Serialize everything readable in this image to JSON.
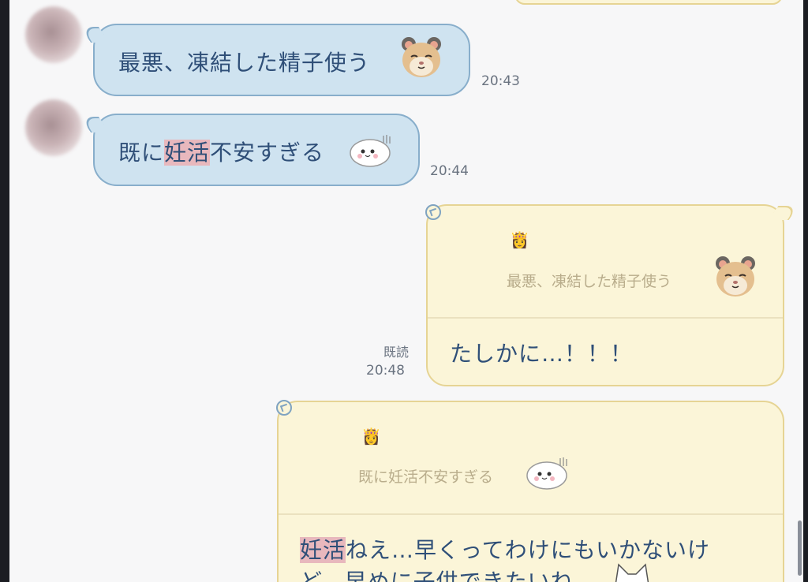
{
  "messages": [
    {
      "id": "m1",
      "direction": "incoming",
      "text": "最悪、凍結した精子使う",
      "sticker": "hamster-emoji",
      "time": "20:43"
    },
    {
      "id": "m2",
      "direction": "incoming",
      "text_pre": "既に",
      "text_hl": "妊活",
      "text_post": "不安すぎる",
      "sticker": "seal-emoji",
      "time": "20:44"
    },
    {
      "id": "m3",
      "direction": "outgoing",
      "quote_user_icon": "👸",
      "quote_text": "最悪、凍結した精子使う",
      "text": "たしかに…！！！",
      "read_label": "既読",
      "time": "20:48"
    },
    {
      "id": "m4",
      "direction": "outgoing",
      "quote_user_icon": "👸",
      "quote_text": "既に妊活不安すぎる",
      "text_hl": "妊活",
      "text_post": "ねえ…早くってわけにもいかないけ",
      "text_line2": "ど、早めに子供できたいね"
    }
  ],
  "colors": {
    "incoming_bubble": "#cfe3f0",
    "incoming_border": "#88aecb",
    "outgoing_bubble": "#fbf5d8",
    "outgoing_border": "#e6d494",
    "highlight": "#e8b8bd",
    "text": "#2f4f78"
  }
}
